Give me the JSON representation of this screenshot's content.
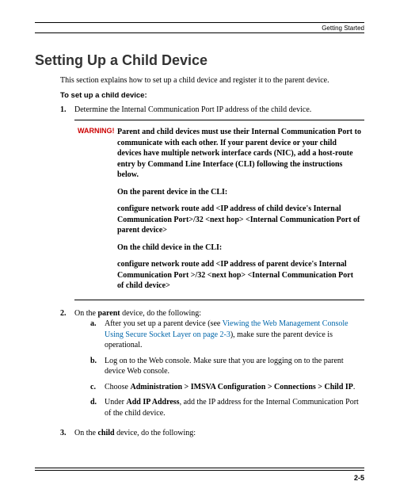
{
  "header": {
    "section": "Getting Started"
  },
  "title": "Setting Up a Child Device",
  "intro": "This section explains how to set up a child device and register it to the parent device.",
  "procedure_heading": "To set up a child device:",
  "step1": {
    "num": "1.",
    "text": "Determine the Internal Communication Port IP address of the child device."
  },
  "warning": {
    "label": "WARNING!",
    "p1": "Parent and child devices must use their Internal Communication Port to communicate with each other. If your parent device or your child devices have multiple network interface cards (NIC), add a host-route entry by Command Line Interface (CLI) following the instructions below.",
    "p2": "On the parent device in the CLI:",
    "p3": "configure network route add <IP address of child device's Internal Communication Port>/32 <next hop> <Internal Communication Port of parent device>",
    "p4": "On the child device in the CLI:",
    "p5": "configure network route add <IP address of parent device's Internal Communication Port >/32 <next hop> <Internal Communication Port of child device>"
  },
  "step2": {
    "num": "2.",
    "pre": "On the ",
    "bold": "parent",
    "post": " device, do the following:",
    "a": {
      "let": "a.",
      "pre": "After you set up a parent device (see ",
      "link": "Viewing the Web Management Console Using Secure Socket Layer on page 2-3",
      "post": "), make sure the parent device is operational."
    },
    "b": {
      "let": "b.",
      "text": "Log on to the Web console. Make sure that you are logging on to the parent device Web console."
    },
    "c": {
      "let": "c.",
      "pre": "Choose ",
      "bold": "Administration > IMSVA Configuration > Connections > Child IP",
      "post": "."
    },
    "d": {
      "let": "d.",
      "pre": "Under ",
      "bold": "Add IP Address",
      "post": ", add the IP address for the Internal Communication Port of the child device."
    }
  },
  "step3": {
    "num": "3.",
    "pre": "On the ",
    "bold": "child",
    "post": " device, do the following:"
  },
  "footer": {
    "pagenum": "2-5"
  }
}
